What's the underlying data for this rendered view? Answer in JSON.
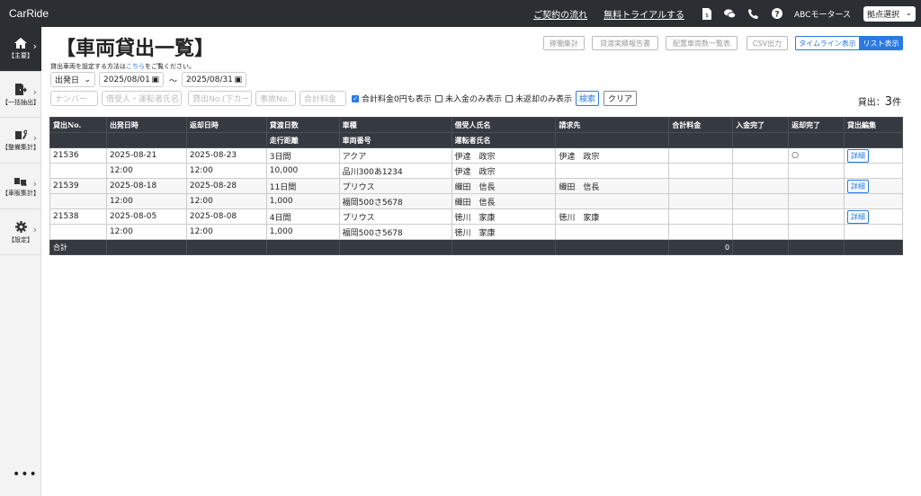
{
  "app": {
    "title": "CarRide"
  },
  "header": {
    "contract_flow": "ご契約の流れ",
    "free_trial": "無料トライアルする",
    "company": "ABCモータース",
    "branch_select": "拠点選択"
  },
  "sidebar": {
    "items": [
      {
        "label": "【主要】",
        "icon": "home-icon"
      },
      {
        "label": "【一括抽出】",
        "icon": "export-icon"
      },
      {
        "label": "【整備集計】",
        "icon": "wrench-icon"
      },
      {
        "label": "【車販集計】",
        "icon": "car-icon"
      },
      {
        "label": "【設定】",
        "icon": "gear-icon"
      }
    ],
    "more": "•••"
  },
  "page": {
    "title": "【車両貸出一覧】",
    "note_prefix": "貸出車両を設定する方法は",
    "note_link": "こちら",
    "note_suffix": "をご覧ください。"
  },
  "toolbar": {
    "btn_operation": "稼働集計",
    "btn_report": "貸渡実績報告書",
    "btn_count": "配置車両数一覧表",
    "btn_csv": "CSV出力",
    "view_timeline": "タイムライン表示",
    "view_list": "リスト表示"
  },
  "filters": {
    "date_type": "出発日",
    "date_from": "2025/08/01",
    "tilde": "〜",
    "date_to": "2025/08/31",
    "number_ph": "ナンバー",
    "name_ph": "借受人・運転者氏名",
    "loan_no_ph": "貸出No.(下カー",
    "accident_ph": "事故No.",
    "total_ph": "合計料金",
    "chk_zero": "合計料金0円も表示",
    "chk_unpaid": "未入金のみ表示",
    "chk_unreturned": "未返却のみ表示",
    "search": "検索",
    "clear": "クリア"
  },
  "count": {
    "prefix": "貸出：",
    "value": "3",
    "suffix": "件"
  },
  "table": {
    "headers_top": [
      "貸出No.",
      "出発日時",
      "返却日時",
      "貸渡日数",
      "車種",
      "借受人氏名",
      "請求先",
      "合計料金",
      "入金完了",
      "返却完了",
      "貸出編集"
    ],
    "headers_bottom": [
      "",
      "",
      "",
      "走行距離",
      "車両番号",
      "運転者氏名",
      "",
      "",
      "",
      "",
      ""
    ],
    "rows": [
      {
        "no": "21536",
        "dep_date": "2025-08-21",
        "dep_time": "12:00",
        "ret_date": "2025-08-23",
        "ret_time": "12:00",
        "days": "3日間",
        "distance": "10,000",
        "model": "アクア",
        "plate": "品川300あ1234",
        "borrower": "伊達　政宗",
        "driver": "伊達　政宗",
        "bill_to": "伊達　政宗",
        "total": "",
        "paid": "",
        "returned": "○",
        "edit": "詳細"
      },
      {
        "no": "21539",
        "dep_date": "2025-08-18",
        "dep_time": "12:00",
        "ret_date": "2025-08-28",
        "ret_time": "12:00",
        "days": "11日間",
        "distance": "1,000",
        "model": "プリウス",
        "plate": "福岡500さ5678",
        "borrower": "織田　信長",
        "driver": "織田　信長",
        "bill_to": "織田　信長",
        "total": "",
        "paid": "",
        "returned": "",
        "edit": "詳細"
      },
      {
        "no": "21538",
        "dep_date": "2025-08-05",
        "dep_time": "12:00",
        "ret_date": "2025-08-08",
        "ret_time": "12:00",
        "days": "4日間",
        "distance": "1,000",
        "model": "プリウス",
        "plate": "福岡500さ5678",
        "borrower": "徳川　家康",
        "driver": "徳川　家康",
        "bill_to": "徳川　家康",
        "total": "",
        "paid": "",
        "returned": "",
        "edit": "詳細"
      }
    ],
    "footer_label": "合計",
    "footer_total": "0"
  }
}
